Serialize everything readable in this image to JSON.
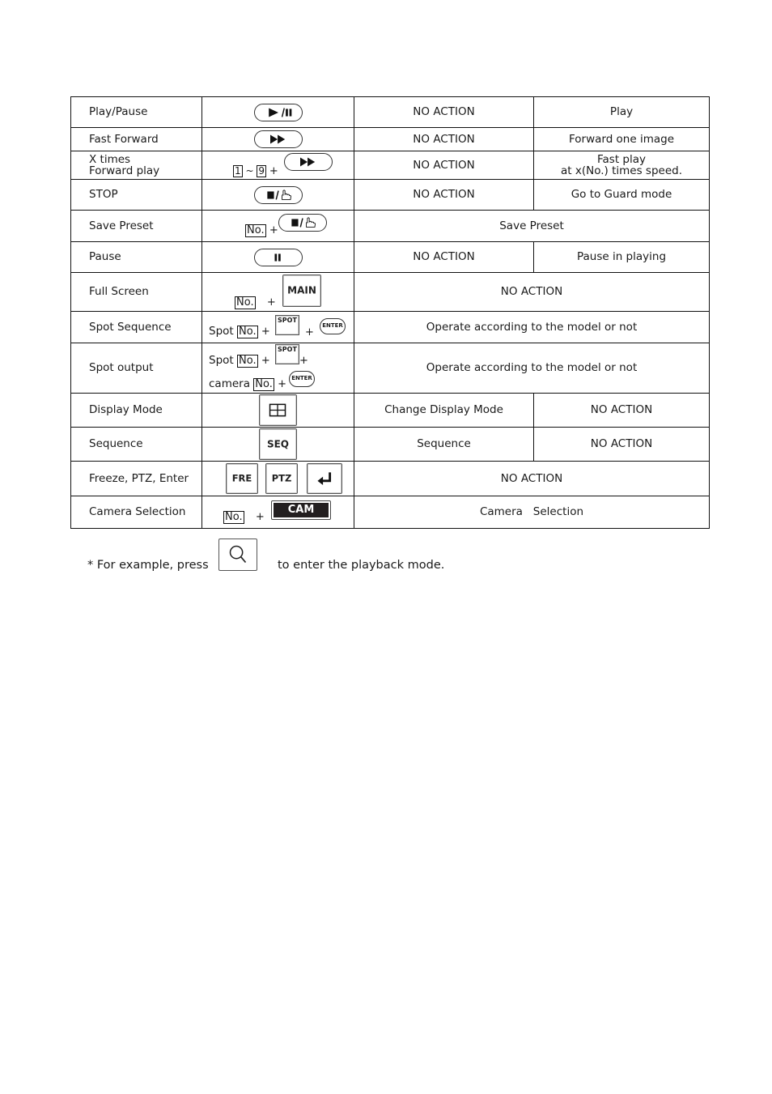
{
  "table": {
    "rows": [
      {
        "function": "Play/Pause",
        "key": "play-pause-key",
        "live": "NO ACTION",
        "playback": "Play"
      },
      {
        "function": "Fast Forward",
        "key": "fast-forward-key",
        "live": "NO ACTION",
        "playback": "Forward one image"
      },
      {
        "function_line1": "X times",
        "function_line2": "Forward play",
        "key_prefix_from": "1",
        "key_prefix_sep": "~",
        "key_prefix_to": "9",
        "key_plus": "+",
        "key": "fast-forward-key",
        "live": "NO ACTION",
        "playback_line1": "Fast play",
        "playback_line2": "at x(No.) times speed."
      },
      {
        "function": "STOP",
        "key": "stop-guard-key",
        "live": "NO ACTION",
        "playback": "Go to Guard mode"
      },
      {
        "function": "Save Preset",
        "key_prefix": "No.",
        "key_plus": "+",
        "key": "stop-guard-key",
        "merged": "Save Preset"
      },
      {
        "function": "Pause",
        "key": "pause-key",
        "live": "NO ACTION",
        "playback": "Pause in playing"
      },
      {
        "function": "Full Screen",
        "key_prefix": "No.",
        "key_plus": "+",
        "key_label": "MAIN",
        "merged": "NO ACTION"
      },
      {
        "function": "Spot Sequence",
        "key_text": "Spot",
        "key_prefix": "No.",
        "key_plus": "+",
        "key_label": "SPOT",
        "key_plus2": "+",
        "key_label2": "ENTER",
        "merged": "Operate according to the model or not"
      },
      {
        "function": "Spot output",
        "key_text": "Spot",
        "key_prefix": "No.",
        "key_plus": "+",
        "key_label": "SPOT",
        "key_plus2": "+",
        "key_text2": "camera",
        "key_prefix2": "No.",
        "key_plus3": "+",
        "key_label2": "ENTER",
        "merged": "Operate according to the model or not"
      },
      {
        "function": "Display Mode",
        "key": "quad-display-key",
        "live": "Change Display Mode",
        "playback": "NO ACTION"
      },
      {
        "function": "Sequence",
        "key_label": "SEQ",
        "live": "Sequence",
        "playback": "NO ACTION"
      },
      {
        "function": "Freeze, PTZ, Enter",
        "key_label": "FRE",
        "key_label2": "PTZ",
        "key": "enter-arrow-key",
        "merged": "NO ACTION"
      },
      {
        "function": "Camera Selection",
        "key_prefix": "No.",
        "key_plus": "+",
        "key_label": "CAM",
        "merged": "Camera   Selection"
      }
    ]
  },
  "note": {
    "before": "* For example, press",
    "key": "search-key",
    "after": "to enter the playback mode."
  }
}
